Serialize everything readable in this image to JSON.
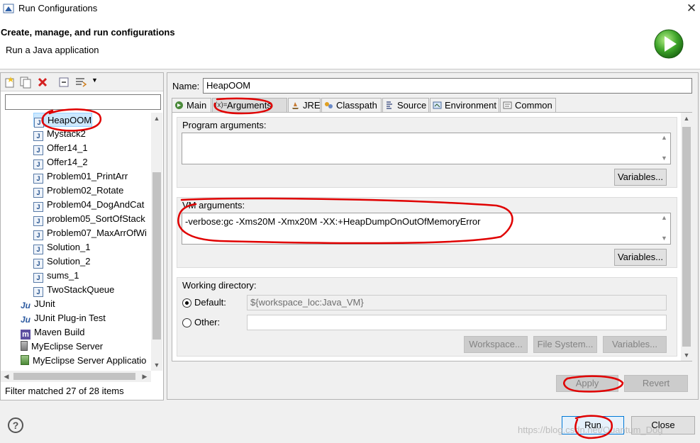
{
  "window": {
    "title": "Run Configurations"
  },
  "header": {
    "title": "Create, manage, and run configurations",
    "subtitle": "Run a Java application"
  },
  "left": {
    "filter_placeholder": "",
    "tree": [
      {
        "label": "HeapOOM",
        "icon": "java-class-icon",
        "selected": true
      },
      {
        "label": "Mystack2",
        "icon": "java-class-icon"
      },
      {
        "label": "Offer14_1",
        "icon": "java-class-icon"
      },
      {
        "label": "Offer14_2",
        "icon": "java-class-icon"
      },
      {
        "label": "Problem01_PrintArr",
        "icon": "java-class-icon"
      },
      {
        "label": "Problem02_Rotate",
        "icon": "java-class-icon"
      },
      {
        "label": "Problem04_DogAndCat",
        "icon": "java-class-icon"
      },
      {
        "label": "problem05_SortOfStack",
        "icon": "java-class-icon"
      },
      {
        "label": "Problem07_MaxArrOfWi",
        "icon": "java-class-icon"
      },
      {
        "label": "Solution_1",
        "icon": "java-class-icon"
      },
      {
        "label": "Solution_2",
        "icon": "java-class-icon"
      },
      {
        "label": "sums_1",
        "icon": "java-class-icon"
      },
      {
        "label": "TwoStackQueue",
        "icon": "java-class-icon"
      },
      {
        "label": "JUnit",
        "icon": "junit-icon"
      },
      {
        "label": "JUnit Plug-in Test",
        "icon": "junit-plugin-icon"
      },
      {
        "label": "Maven Build",
        "icon": "maven-icon"
      },
      {
        "label": "MyEclipse Server",
        "icon": "server-icon"
      },
      {
        "label": "MyEclipse Server Applicatio",
        "icon": "server-app-icon"
      }
    ],
    "status": "Filter matched 27 of 28 items"
  },
  "right": {
    "name_label": "Name:",
    "name_value": "HeapOOM",
    "tabs": [
      {
        "label": "Main"
      },
      {
        "label": "Arguments",
        "active": true
      },
      {
        "label": "JRE"
      },
      {
        "label": "Classpath"
      },
      {
        "label": "Source"
      },
      {
        "label": "Environment"
      },
      {
        "label": "Common"
      }
    ],
    "program_args_label": "Program arguments:",
    "program_args_value": "",
    "variables_label": "Variables...",
    "vm_args_label": "VM arguments:",
    "vm_args_value": "-verbose:gc -Xms20M -Xmx20M -XX:+HeapDumpOnOutOfMemoryError",
    "working_dir_label": "Working directory:",
    "default_label": "Default:",
    "default_value": "${workspace_loc:Java_VM}",
    "other_label": "Other:",
    "other_value": "",
    "workspace_btn": "Workspace...",
    "filesystem_btn": "File System...",
    "wd_variables_btn": "Variables...",
    "apply": "Apply",
    "revert": "Revert"
  },
  "footer": {
    "run": "Run",
    "close": "Close",
    "help": "?",
    "watermark": "https://blog.csdn.net/Quantum_Dog"
  }
}
